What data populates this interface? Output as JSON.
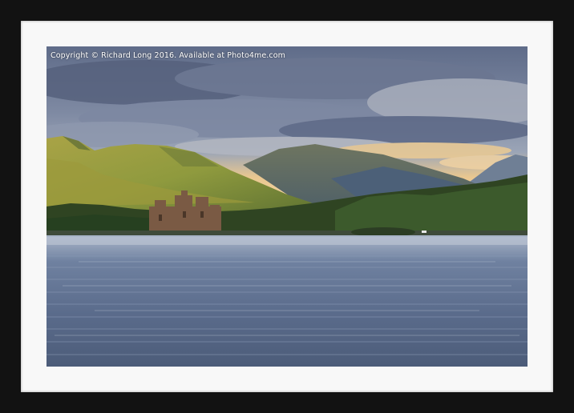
{
  "watermark": {
    "text": "Copyright  © Richard Long  2016. Available at Photo4me.com"
  },
  "scene": {
    "subject": "loch landscape with ruined castle",
    "colors": {
      "frame": "#121212",
      "mount": "#f8f8f8",
      "sky_top": "#6d7a93",
      "sky_glow": "#f0c98a",
      "hills": "#8d9a3f",
      "water": "#5d6f8e"
    }
  }
}
